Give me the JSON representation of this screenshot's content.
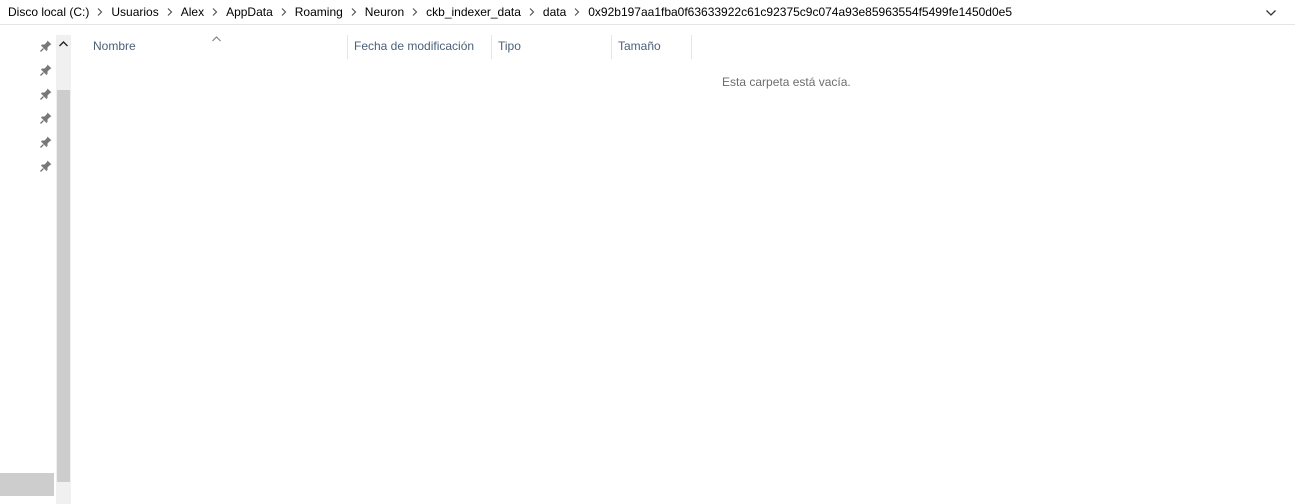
{
  "address_bar": {
    "crumbs": [
      "Disco local (C:)",
      "Usuarios",
      "Alex",
      "AppData",
      "Roaming",
      "Neuron",
      "ckb_indexer_data",
      "data",
      "0x92b197aa1fba0f63633922c61c92375c9c074a93e85963554f5499fe1450d0e5"
    ]
  },
  "columns": {
    "name": "Nombre",
    "modified": "Fecha de modificación",
    "type": "Tipo",
    "size": "Tamaño"
  },
  "empty_message": "Esta carpeta está vacía.",
  "icons": {
    "pin": "pin-icon",
    "separator": "chevron-right-icon",
    "dropdown": "chevron-down-icon",
    "sort": "sort-ascending-icon"
  },
  "colors": {
    "column_header_text": "#4c607a",
    "scrollbar_track": "#f0f0f0",
    "scrollbar_thumb": "#cdcdcd"
  }
}
